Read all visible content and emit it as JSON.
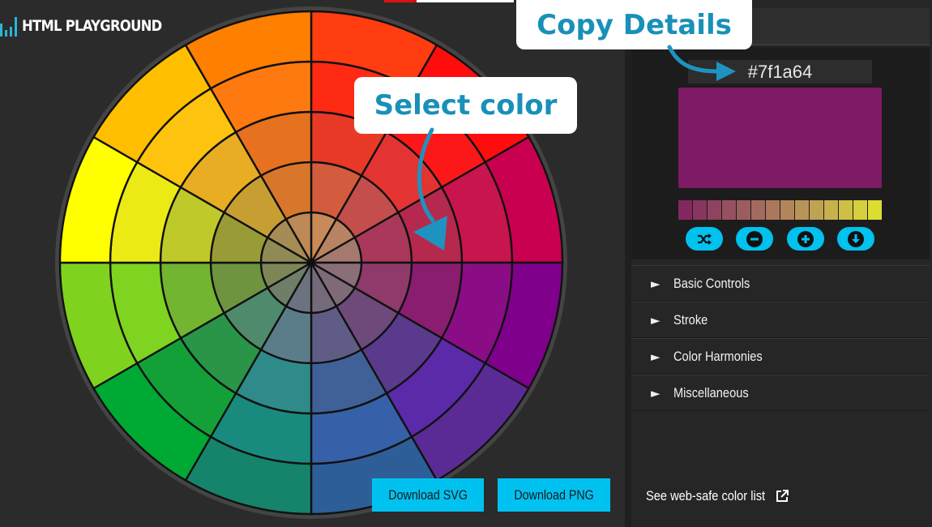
{
  "app": {
    "logo_text": "HTML PLAYGROUND"
  },
  "picker": {
    "hex_value": "#7f1a64",
    "preview_color": "#7f1a64",
    "swatches": [
      "#83285f",
      "#8a3560",
      "#904360",
      "#975060",
      "#9d5d60",
      "#a46a5f",
      "#ab785d",
      "#b2865a",
      "#b99457",
      "#c0a253",
      "#c7b14d",
      "#cec046",
      "#d5cf3d",
      "#dcdd33"
    ],
    "tools": [
      {
        "name": "shuffle-icon"
      },
      {
        "name": "minus-icon"
      },
      {
        "name": "plus-icon"
      },
      {
        "name": "download-arrow-icon"
      }
    ]
  },
  "sections": [
    {
      "label": "Basic Controls"
    },
    {
      "label": "Stroke"
    },
    {
      "label": "Color Harmonies"
    },
    {
      "label": "Miscellaneous"
    }
  ],
  "buttons": {
    "download_svg": "Download SVG",
    "download_png": "Download PNG"
  },
  "websafe_link": "See web-safe color list",
  "callouts": {
    "copy": "Copy Details",
    "select": "Select color"
  },
  "colors": {
    "accent": "#00c2ee",
    "callout_text": "#1990b8",
    "panel_bg": "#262626",
    "page_bg": "#2b2b2b"
  },
  "wheel": {
    "rings": [
      [
        "#c98a57",
        "#b88363",
        "#a47a6e",
        "#8a6e78",
        "#7f6a79",
        "#756a7a",
        "#6a737f",
        "#6e7e69",
        "#7e8658",
        "#908b54",
        "#a78b55",
        "#bd8957"
      ],
      [
        "#d25c3d",
        "#c44e4b",
        "#a9385a",
        "#8f3a6b",
        "#6d4a7a",
        "#5f5d86",
        "#5b7d8a",
        "#4f8a6c",
        "#6e9440",
        "#999b36",
        "#c79e32",
        "#d8762c"
      ],
      [
        "#e83a26",
        "#e33433",
        "#b5294e",
        "#8a1d6f",
        "#5a3a8d",
        "#3f6197",
        "#2f8a8a",
        "#2a9449",
        "#72b530",
        "#c0c92a",
        "#e8ad22",
        "#e6711f"
      ],
      [
        "#fe2a14",
        "#fc1818",
        "#c8154d",
        "#8a0d86",
        "#5a2aa8",
        "#3660a8",
        "#198a7e",
        "#14a038",
        "#7ed420",
        "#ecea15",
        "#fec30f",
        "#fe7a10"
      ],
      [
        "#ff3d10",
        "#ff0d0d",
        "#c8004f",
        "#7f008a",
        "#5a2b95",
        "#2e5e98",
        "#15846b",
        "#00a834",
        "#7fd31f",
        "#ffff00",
        "#ffbe00",
        "#ff7f00"
      ]
    ]
  }
}
